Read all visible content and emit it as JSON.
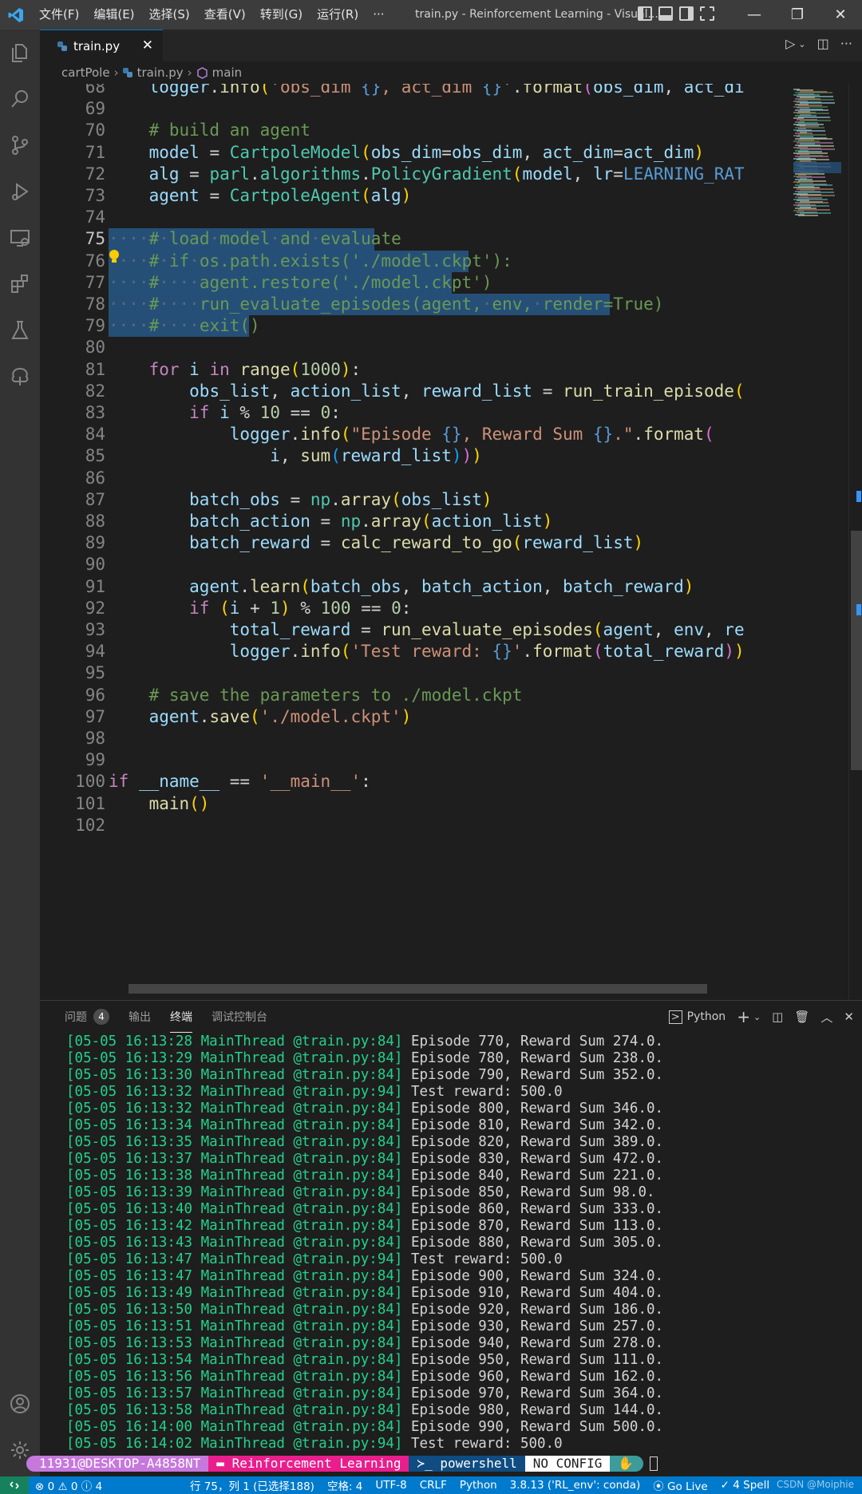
{
  "titlebar": {
    "menu": [
      "文件(F)",
      "编辑(E)",
      "选择(S)",
      "查看(V)",
      "转到(G)",
      "运行(R)",
      "···"
    ],
    "title": "train.py - Reinforcement Learning - Visual..."
  },
  "tab": {
    "name": "train.py",
    "close": "✕"
  },
  "breadcrumb": {
    "folder": "cartPole",
    "file": "train.py",
    "symbol": "main"
  },
  "editor": {
    "current_line": 75,
    "lines": [
      {
        "n": "68",
        "html": "    <span class=\"var\">logger</span>.<span class=\"fn\">info</span><span class=\"p1\">(</span><span class=\"str\">'obs_dim </span><span class=\"bl\">{}</span><span class=\"str\">, act_dim </span><span class=\"bl\">{}</span><span class=\"str\">'</span>.<span class=\"fn\">format</span><span class=\"p2\">(</span><span class=\"var\">obs_dim</span>, <span class=\"var\">act_di</span>"
      },
      {
        "n": "69",
        "html": ""
      },
      {
        "n": "70",
        "html": "    <span class=\"cm\"># build an agent</span>"
      },
      {
        "n": "71",
        "html": "    <span class=\"var\">model</span> = <span class=\"cls\">CartpoleModel</span><span class=\"p1\">(</span><span class=\"var\">obs_dim</span>=<span class=\"var\">obs_dim</span>, <span class=\"var\">act_dim</span>=<span class=\"var\">act_dim</span><span class=\"p1\">)</span>"
      },
      {
        "n": "72",
        "html": "    <span class=\"var\">alg</span> = <span class=\"cls\">parl</span>.<span class=\"cls\">algorithms</span>.<span class=\"cls\">PolicyGradient</span><span class=\"p1\">(</span><span class=\"var\">model</span>, <span class=\"var\">lr</span>=<span class=\"bl\">LEARNING_RAT</span>"
      },
      {
        "n": "73",
        "html": "    <span class=\"var\">agent</span> = <span class=\"cls\">CartpoleAgent</span><span class=\"p1\">(</span><span class=\"var\">alg</span><span class=\"p1\">)</span>"
      },
      {
        "n": "74",
        "html": ""
      },
      {
        "n": "75",
        "html": "<span class=\"ws\">····</span><span class=\"cm\">#<span class=\"ws\">·</span>load<span class=\"ws\">·</span>model<span class=\"ws\">·</span>and<span class=\"ws\">·</span>evaluate</span>"
      },
      {
        "n": "76",
        "html": "<span class=\"ws\">····</span><span class=\"cm\">#<span class=\"ws\">·</span>if<span class=\"ws\">·</span>os.path.exists('./model.ckpt'):</span>"
      },
      {
        "n": "77",
        "html": "<span class=\"ws\">····</span><span class=\"cm\">#<span class=\"ws\">····</span>agent.restore('./model.ckpt')</span>"
      },
      {
        "n": "78",
        "html": "<span class=\"ws\">····</span><span class=\"cm\">#<span class=\"ws\">····</span>run_evaluate_episodes(agent,<span class=\"ws\">·</span>env,<span class=\"ws\">·</span>render=True)</span>"
      },
      {
        "n": "79",
        "html": "<span class=\"ws\">····</span><span class=\"cm\">#<span class=\"ws\">····</span>exit()</span>"
      },
      {
        "n": "80",
        "html": ""
      },
      {
        "n": "81",
        "html": "    <span class=\"kw\">for</span> <span class=\"var\">i</span> <span class=\"kw\">in</span> <span class=\"fn\">range</span><span class=\"p1\">(</span><span class=\"num\">1000</span><span class=\"p1\">)</span>:"
      },
      {
        "n": "82",
        "html": "        <span class=\"var\">obs_list</span>, <span class=\"var\">action_list</span>, <span class=\"var\">reward_list</span> = <span class=\"fn\">run_train_episode</span><span class=\"p1\">(</span>"
      },
      {
        "n": "83",
        "html": "        <span class=\"kw\">if</span> <span class=\"var\">i</span> % <span class=\"num\">10</span> == <span class=\"num\">0</span>:"
      },
      {
        "n": "84",
        "html": "            <span class=\"var\">logger</span>.<span class=\"fn\">info</span><span class=\"p1\">(</span><span class=\"str\">\"Episode </span><span class=\"bl\">{}</span><span class=\"str\">, Reward Sum </span><span class=\"bl\">{}</span><span class=\"str\">.\"</span>.<span class=\"fn\">format</span><span class=\"p2\">(</span>"
      },
      {
        "n": "85",
        "html": "                <span class=\"var\">i</span>, <span class=\"fn\">sum</span><span class=\"p3\">(</span><span class=\"var\">reward_list</span><span class=\"p3\">)</span><span class=\"p2\">)</span><span class=\"p1\">)</span>"
      },
      {
        "n": "86",
        "html": ""
      },
      {
        "n": "87",
        "html": "        <span class=\"var\">batch_obs</span> = <span class=\"cls\">np</span>.<span class=\"fn\">array</span><span class=\"p1\">(</span><span class=\"var\">obs_list</span><span class=\"p1\">)</span>"
      },
      {
        "n": "88",
        "html": "        <span class=\"var\">batch_action</span> = <span class=\"cls\">np</span>.<span class=\"fn\">array</span><span class=\"p1\">(</span><span class=\"var\">action_list</span><span class=\"p1\">)</span>"
      },
      {
        "n": "89",
        "html": "        <span class=\"var\">batch_reward</span> = <span class=\"fn\">calc_reward_to_go</span><span class=\"p1\">(</span><span class=\"var\">reward_list</span><span class=\"p1\">)</span>"
      },
      {
        "n": "90",
        "html": ""
      },
      {
        "n": "91",
        "html": "        <span class=\"var\">agent</span>.<span class=\"fn\">learn</span><span class=\"p1\">(</span><span class=\"var\">batch_obs</span>, <span class=\"var\">batch_action</span>, <span class=\"var\">batch_reward</span><span class=\"p1\">)</span>"
      },
      {
        "n": "92",
        "html": "        <span class=\"kw\">if</span> <span class=\"p1\">(</span><span class=\"var\">i</span> + <span class=\"num\">1</span><span class=\"p1\">)</span> % <span class=\"num\">100</span> == <span class=\"num\">0</span>:"
      },
      {
        "n": "93",
        "html": "            <span class=\"var\">total_reward</span> = <span class=\"fn\">run_evaluate_episodes</span><span class=\"p1\">(</span><span class=\"var\">agent</span>, <span class=\"var\">env</span>, <span class=\"var\">re</span>"
      },
      {
        "n": "94",
        "html": "            <span class=\"var\">logger</span>.<span class=\"fn\">info</span><span class=\"p1\">(</span><span class=\"str\">'Test reward: </span><span class=\"bl\">{}</span><span class=\"str\">'</span>.<span class=\"fn\">format</span><span class=\"p2\">(</span><span class=\"var\">total_reward</span><span class=\"p2\">)</span><span class=\"p1\">)</span>"
      },
      {
        "n": "95",
        "html": ""
      },
      {
        "n": "96",
        "html": "    <span class=\"cm\"># save the parameters to ./model.ckpt</span>"
      },
      {
        "n": "97",
        "html": "    <span class=\"var\">agent</span>.<span class=\"fn\">save</span><span class=\"p1\">(</span><span class=\"str\">'./model.ckpt'</span><span class=\"p1\">)</span>"
      },
      {
        "n": "98",
        "html": ""
      },
      {
        "n": "99",
        "html": ""
      },
      {
        "n": "100",
        "html": "<span class=\"kw\">if</span> <span class=\"var\">__name__</span> == <span class=\"str\">'__main__'</span>:"
      },
      {
        "n": "101",
        "html": "    <span class=\"fn\">main</span><span class=\"p1\">()</span>"
      },
      {
        "n": "102",
        "html": ""
      }
    ]
  },
  "panel": {
    "tabs": [
      {
        "label": "问题",
        "badge": "4"
      },
      {
        "label": "输出"
      },
      {
        "label": "终端",
        "active": true
      },
      {
        "label": "调试控制台"
      }
    ],
    "terminal_type": "Python",
    "terminal_lines": [
      {
        "p": "[05-05 16:13:28 MainThread @train.py:84]",
        "m": "Episode 770, Reward Sum 274.0."
      },
      {
        "p": "[05-05 16:13:29 MainThread @train.py:84]",
        "m": "Episode 780, Reward Sum 238.0."
      },
      {
        "p": "[05-05 16:13:30 MainThread @train.py:84]",
        "m": "Episode 790, Reward Sum 352.0."
      },
      {
        "p": "[05-05 16:13:32 MainThread @train.py:94]",
        "m": "Test reward: 500.0"
      },
      {
        "p": "[05-05 16:13:32 MainThread @train.py:84]",
        "m": "Episode 800, Reward Sum 346.0."
      },
      {
        "p": "[05-05 16:13:34 MainThread @train.py:84]",
        "m": "Episode 810, Reward Sum 342.0."
      },
      {
        "p": "[05-05 16:13:35 MainThread @train.py:84]",
        "m": "Episode 820, Reward Sum 389.0."
      },
      {
        "p": "[05-05 16:13:37 MainThread @train.py:84]",
        "m": "Episode 830, Reward Sum 472.0."
      },
      {
        "p": "[05-05 16:13:38 MainThread @train.py:84]",
        "m": "Episode 840, Reward Sum 221.0."
      },
      {
        "p": "[05-05 16:13:39 MainThread @train.py:84]",
        "m": "Episode 850, Reward Sum 98.0."
      },
      {
        "p": "[05-05 16:13:40 MainThread @train.py:84]",
        "m": "Episode 860, Reward Sum 333.0."
      },
      {
        "p": "[05-05 16:13:42 MainThread @train.py:84]",
        "m": "Episode 870, Reward Sum 113.0."
      },
      {
        "p": "[05-05 16:13:43 MainThread @train.py:84]",
        "m": "Episode 880, Reward Sum 305.0."
      },
      {
        "p": "[05-05 16:13:47 MainThread @train.py:94]",
        "m": "Test reward: 500.0"
      },
      {
        "p": "[05-05 16:13:47 MainThread @train.py:84]",
        "m": "Episode 900, Reward Sum 324.0."
      },
      {
        "p": "[05-05 16:13:49 MainThread @train.py:84]",
        "m": "Episode 910, Reward Sum 404.0."
      },
      {
        "p": "[05-05 16:13:50 MainThread @train.py:84]",
        "m": "Episode 920, Reward Sum 186.0."
      },
      {
        "p": "[05-05 16:13:51 MainThread @train.py:84]",
        "m": "Episode 930, Reward Sum 257.0."
      },
      {
        "p": "[05-05 16:13:53 MainThread @train.py:84]",
        "m": "Episode 940, Reward Sum 278.0."
      },
      {
        "p": "[05-05 16:13:54 MainThread @train.py:84]",
        "m": "Episode 950, Reward Sum 111.0."
      },
      {
        "p": "[05-05 16:13:56 MainThread @train.py:84]",
        "m": "Episode 960, Reward Sum 162.0."
      },
      {
        "p": "[05-05 16:13:57 MainThread @train.py:84]",
        "m": "Episode 970, Reward Sum 364.0."
      },
      {
        "p": "[05-05 16:13:58 MainThread @train.py:84]",
        "m": "Episode 980, Reward Sum 144.0."
      },
      {
        "p": "[05-05 16:14:00 MainThread @train.py:84]",
        "m": "Episode 990, Reward Sum 500.0."
      },
      {
        "p": "[05-05 16:14:02 MainThread @train.py:94]",
        "m": "Test reward: 500.0"
      }
    ],
    "prompt": {
      "user": "11931@DESKTOP-A4858NT",
      "folder": "Reinforcement Learning",
      "shell": "powershell",
      "config": "NO CONFIG",
      "hand": "✋"
    }
  },
  "statusbar": {
    "errors": "0",
    "warnings": "0",
    "infos": "4",
    "position": "行 75，列 1 (已选择188)",
    "spaces": "空格: 4",
    "encoding": "UTF-8",
    "eol": "CRLF",
    "language": "Python",
    "interpreter": "3.8.13 ('RL_env': conda)",
    "golive": "Go Live",
    "spell": "4 Spell",
    "watermark": "CSDN @Moiphie"
  },
  "colors": {
    "accent": "#007acc",
    "terminal_green": "#23d18b",
    "selection": "#264f78"
  }
}
